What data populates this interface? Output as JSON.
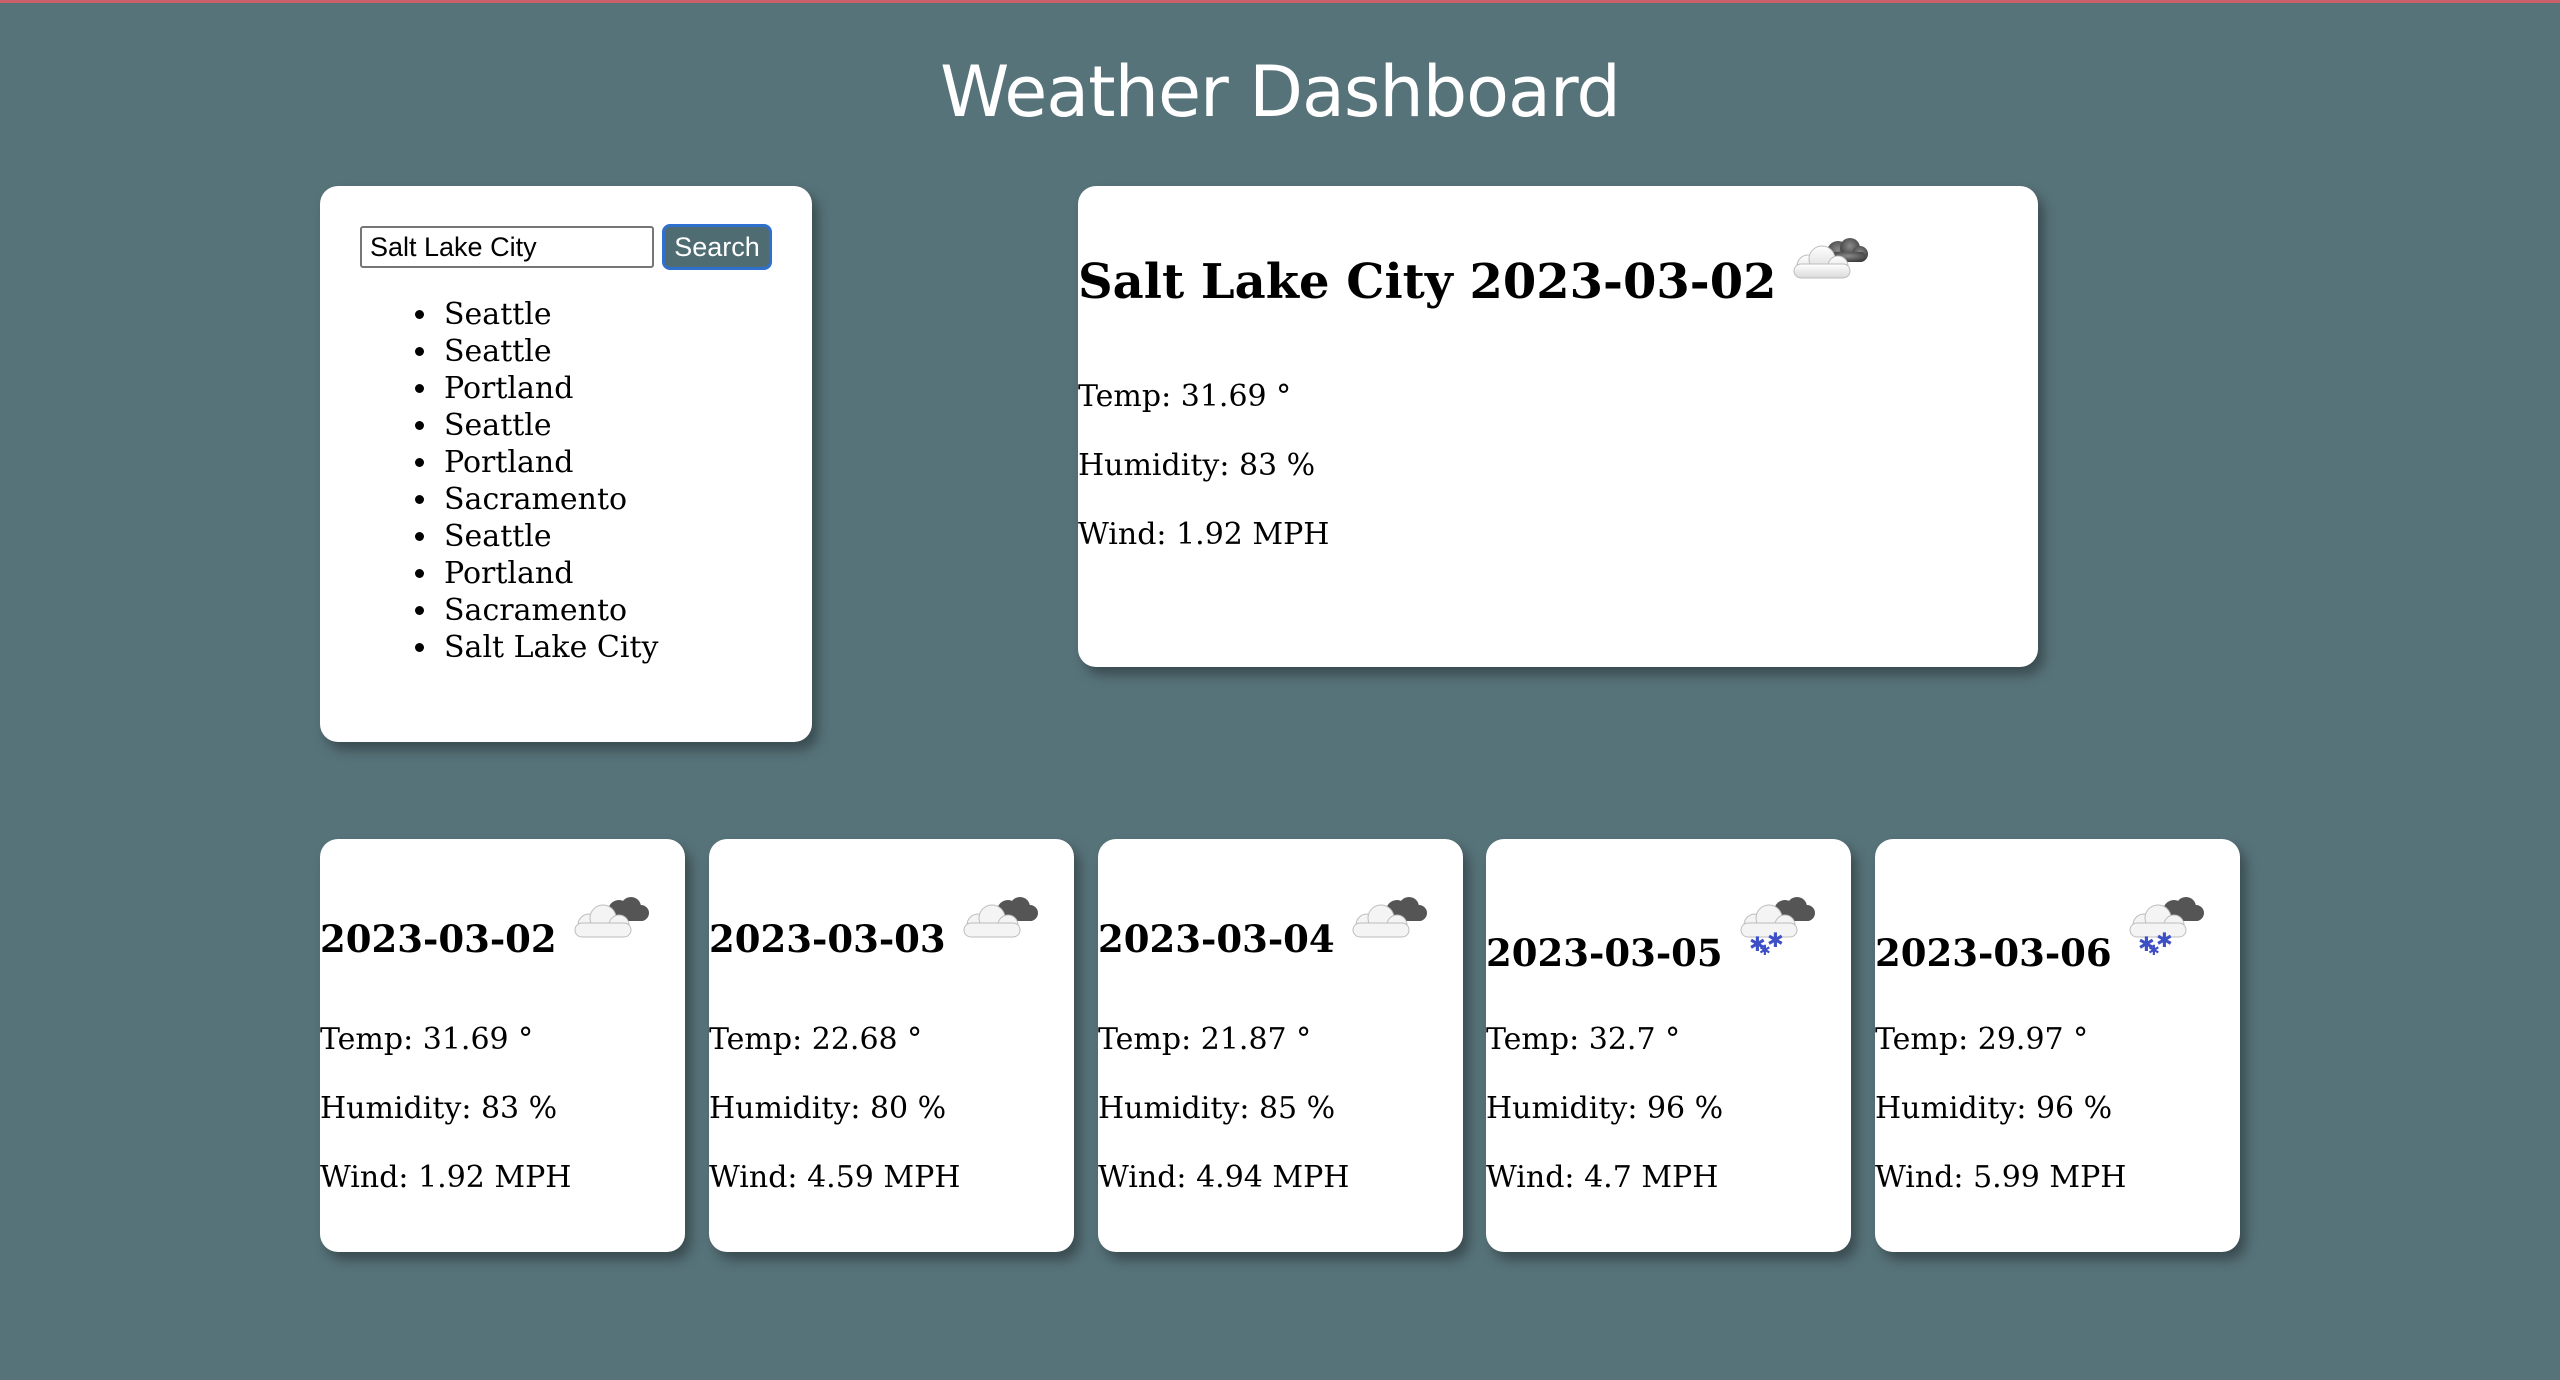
{
  "header": {
    "title": "Weather Dashboard"
  },
  "search": {
    "input_value": "Salt Lake City",
    "button_label": "Search"
  },
  "history": [
    "Seattle",
    "Seattle",
    "Portland",
    "Seattle",
    "Portland",
    "Sacramento",
    "Seattle",
    "Portland",
    "Sacramento",
    "Salt Lake City"
  ],
  "current": {
    "title": "Salt Lake City 2023-03-02",
    "icon": "cloudy-icon",
    "temp": "Temp: 31.69 °",
    "humidity": "Humidity: 83 %",
    "wind": "Wind: 1.92 MPH"
  },
  "forecast": [
    {
      "date": "2023-03-02",
      "icon": "cloudy-icon",
      "temp": "Temp: 31.69 °",
      "humidity": "Humidity: 83 %",
      "wind": "Wind: 1.92 MPH"
    },
    {
      "date": "2023-03-03",
      "icon": "cloudy-icon",
      "temp": "Temp: 22.68 °",
      "humidity": "Humidity: 80 %",
      "wind": "Wind: 4.59 MPH"
    },
    {
      "date": "2023-03-04",
      "icon": "cloudy-icon",
      "temp": "Temp: 21.87 °",
      "humidity": "Humidity: 85 %",
      "wind": "Wind: 4.94 MPH"
    },
    {
      "date": "2023-03-05",
      "icon": "snow-icon",
      "temp": "Temp: 32.7 °",
      "humidity": "Humidity: 96 %",
      "wind": "Wind: 4.7 MPH"
    },
    {
      "date": "2023-03-06",
      "icon": "snow-icon",
      "temp": "Temp: 29.97 °",
      "humidity": "Humidity: 96 %",
      "wind": "Wind: 5.99 MPH"
    }
  ],
  "colors": {
    "background": "#57737a",
    "accent_bar": "#c9606a",
    "button_bg": "#4f6c73",
    "button_border": "#2f6fce",
    "card": "#ffffff"
  }
}
